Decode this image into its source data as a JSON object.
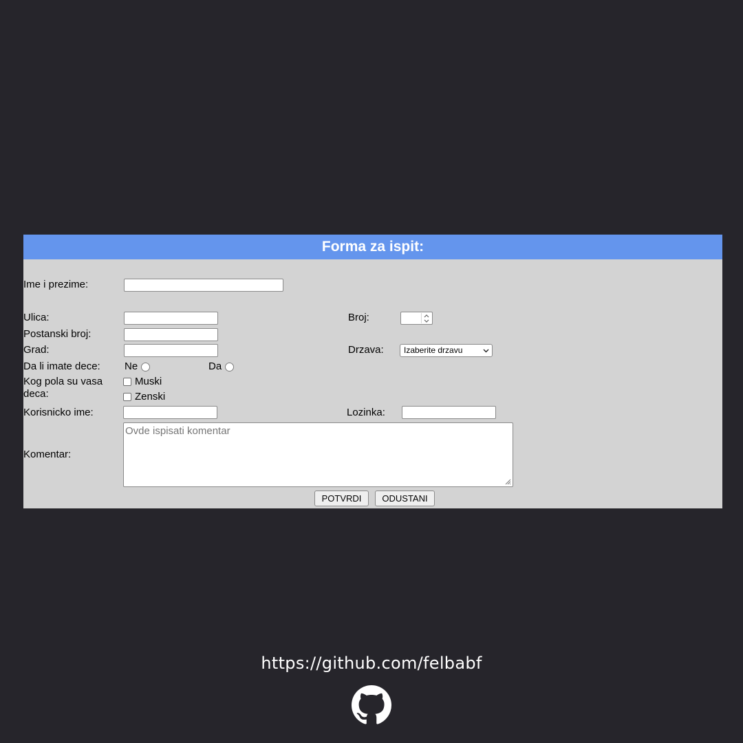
{
  "form": {
    "title": "Forma za ispit:",
    "labels": {
      "full_name": "Ime i prezime:",
      "street": "Ulica:",
      "number": "Broj:",
      "postal_code": "Postanski broj:",
      "city": "Grad:",
      "country": "Drzava:",
      "children_question": "Da li imate dece:",
      "gender_question": "Kog pola su vasa deca:",
      "username": "Korisnicko ime:",
      "password": "Lozinka:",
      "comment": "Komentar:"
    },
    "inputs": {
      "full_name": "",
      "street": "",
      "number": "",
      "postal_code": "",
      "city": "",
      "username": "",
      "password": ""
    },
    "country_select": {
      "selected": "Izaberite drzavu"
    },
    "children_options": [
      "Ne",
      "Da"
    ],
    "gender_options": [
      "Muski",
      "Zenski"
    ],
    "comment_placeholder": "Ovde ispisati komentar",
    "buttons": {
      "submit": "POTVRDI",
      "cancel": "ODUSTANI"
    }
  },
  "footer": {
    "link": "https://github.com/felbabf",
    "icon": "github-icon"
  },
  "colors": {
    "background": "#26252b",
    "panel": "#d3d3d3",
    "header": "#6495ed"
  }
}
